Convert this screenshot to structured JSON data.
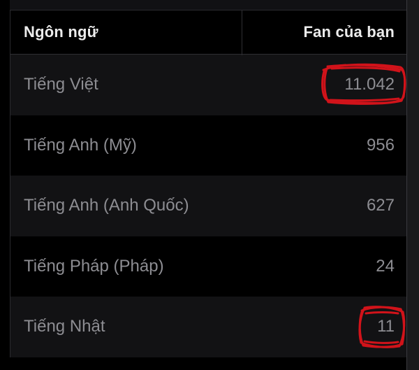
{
  "table": {
    "headers": {
      "language": "Ngôn ngữ",
      "fans": "Fan của bạn"
    },
    "rows": [
      {
        "language": "Tiếng Việt",
        "fans": "11.042"
      },
      {
        "language": "Tiếng Anh (Mỹ)",
        "fans": "956"
      },
      {
        "language": "Tiếng Anh (Anh Quốc)",
        "fans": "627"
      },
      {
        "language": "Tiếng Pháp (Pháp)",
        "fans": "24"
      },
      {
        "language": "Tiếng Nhật",
        "fans": "11"
      }
    ]
  },
  "colors": {
    "background": "#000000",
    "row_alt": "#121214",
    "header_text": "#ececec",
    "cell_text": "#8d8d92",
    "annotation": "#d1131a"
  },
  "annotations": [
    {
      "type": "scribble-circle",
      "target": "rows.0.fans"
    },
    {
      "type": "scribble-circle",
      "target": "rows.4.fans"
    }
  ]
}
